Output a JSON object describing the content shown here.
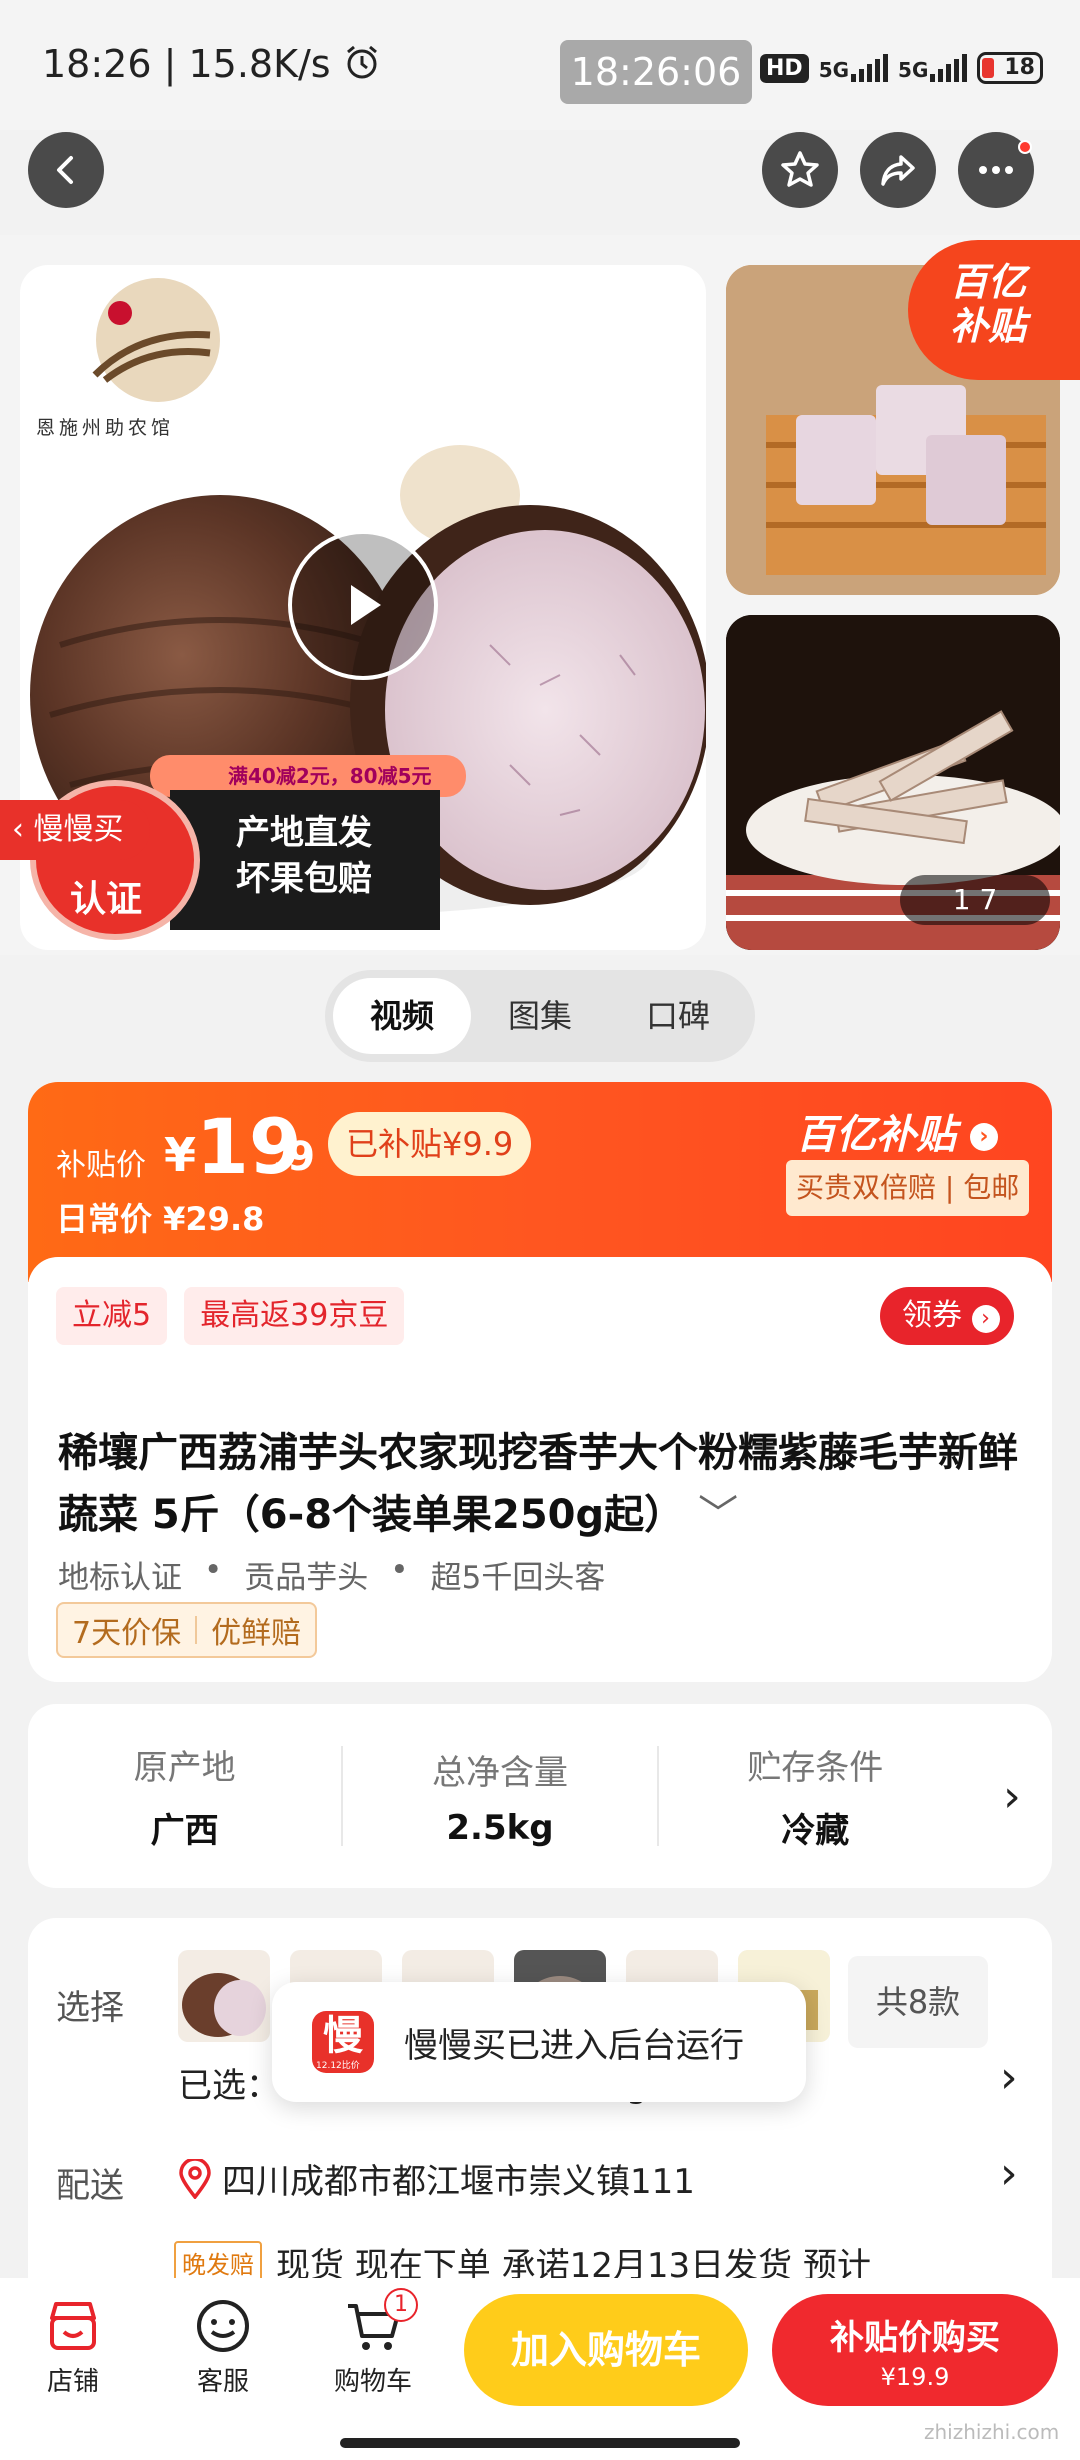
{
  "status_bar": {
    "time_speed": "18:26 | 15.8K/s",
    "clock_overlay": "18:26:06",
    "hd": "HD",
    "net1": "5G",
    "net2": "5G",
    "battery": "18"
  },
  "gallery": {
    "shop_logo_text": "恩施州助农馆",
    "subsidy_badge_line1": "百亿",
    "subsidy_badge_line2": "补贴",
    "promo": "满40减2元，80减5元",
    "slowbuy_line1": "慢慢买",
    "slowbuy_line2": "认证",
    "origin_line1": "产地直发",
    "origin_line2": "坏果包赔",
    "counter": "1   7"
  },
  "tabs": [
    "视频",
    "图集",
    "口碑"
  ],
  "price": {
    "label": "补贴价",
    "currency": "¥",
    "integer": "19",
    "decimal": ".9",
    "subsidized": "已补贴¥9.9",
    "regular": "日常价 ¥29.8",
    "brand": "百亿补贴",
    "brand_sub": "买贵双倍赔 | 包邮",
    "colors": {
      "accent": "#ff5620",
      "buy": "#f0292e",
      "cart": "#ffcc1a"
    }
  },
  "offers": {
    "chip1": "立减5",
    "chip2": "最高返39京豆",
    "coupon": "领券"
  },
  "product": {
    "title": "稀壤广西荔浦芋头农家现挖香芋大个粉糯紫藤毛芋新鲜蔬菜 5斤（6-8个装单果250g起）",
    "tags": [
      "地标认证",
      "贡品芋头",
      "超5千回头客"
    ],
    "guarantee1": "7天价保",
    "guarantee2": "优鲜赔"
  },
  "specs": [
    {
      "key": "原产地",
      "value": "广西"
    },
    {
      "key": "总净含量",
      "value": "2.5kg"
    },
    {
      "key": "贮存条件",
      "value": "冷藏"
    }
  ],
  "selection": {
    "label": "选择",
    "count": "共8款",
    "selected": "已选：5斤（6-8个装单果250g起），1件",
    "delivery_label": "配送",
    "address": "四川成都市都江堰市崇义镇111",
    "late_tag": "晚发赔",
    "delivery_text": "现货   现在下单   承诺12月13日发货   预计"
  },
  "toast": {
    "text": "慢慢买已进入后台运行",
    "icon_char": "慢",
    "icon_sub": "12.12比价"
  },
  "bottom": {
    "shop": "店铺",
    "service": "客服",
    "cart": "购物车",
    "cart_badge": "1",
    "add_cart": "加入购物车",
    "buy": "补贴价购买",
    "buy_price": "¥19.9"
  },
  "watermark": "zhizhizhi.com"
}
